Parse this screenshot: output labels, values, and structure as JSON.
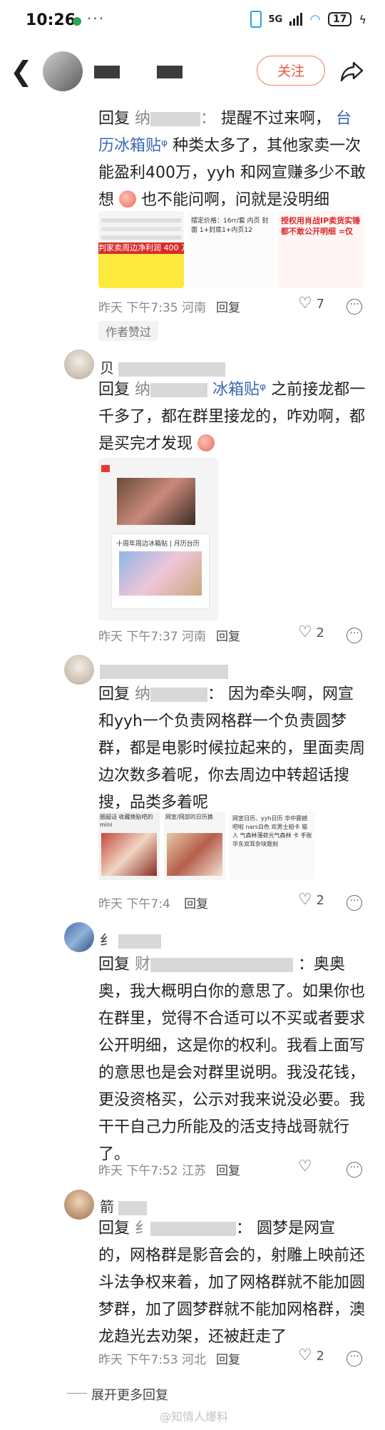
{
  "status_bar": {
    "time": "10:26",
    "network": "5G",
    "battery": "17"
  },
  "header": {
    "follow_label": "关注"
  },
  "comments": [
    {
      "reply_label": "回复",
      "target": "纳",
      "target_suffix": "：",
      "text_before_topic": "提醒不过来啊，",
      "topic": "台历冰箱贴",
      "text_after_topic": "种类太多了，其他家卖一次能盈利400万，yyh 和网宣赚多少不敢想",
      "text_end": "也不能问啊，问就是没明细",
      "thumb_captions": [
        "判家卖周边净利润 400 万",
        "摆定价格：16rr/套 内页 封面 1+封底1+内页12",
        "授权用肖战IP卖货实锤 都不敢公开明细 =仅"
      ],
      "time": "昨天 下午7:35",
      "location": "河南",
      "reply_link": "回复",
      "likes": "7",
      "badge": "作者赞过"
    },
    {
      "name": "贝",
      "reply_label": "回复",
      "target": "纳",
      "topic": "冰箱贴",
      "text": "之前接龙都一千多了，都在群里接龙的，咋劝啊，都是买完才发现",
      "thumb_captions": [
        "十周年周边冰箱贴 | 月历台历"
      ],
      "time": "昨天 下午7:37",
      "location": "河南",
      "reply_link": "回复",
      "likes": "2"
    },
    {
      "reply_label": "回复",
      "target": "纳",
      "text": "因为牵头啊，网宣和yyh一个负责网格群一个负责圆梦群，都是电影时候拉起来的，里面卖周边次数多着呢，你去周边中转超话搜搜，品类多着呢",
      "thumb_captions": [
        "圈超话 收藏挽贴吧的mini",
        "网宣/网部的日历换",
        "网宣日历、yyh日历 华中震撼吧啦 nars白色 欢男士拍卡 猫人 气森林薄荷元气森林 卡 手账 华东双耳杂块题刻"
      ],
      "time": "昨天 下午7:4",
      "location": "",
      "reply_link": "回复",
      "likes": "2"
    },
    {
      "name": "纟",
      "reply_label": "回复",
      "target": "财",
      "text": "：奥奥奥，我大概明白你的意思了。如果你也在群里，觉得不合适可以不买或者要求公开明细，这是你的权利。我看上面写的意思也是会对群里说明。我没花钱，更没资格买，公示对我来说没必要。我干干自己力所能及的活支持战哥就行了。",
      "time": "昨天 下午7:52",
      "location": "江苏",
      "reply_link": "回复",
      "likes": ""
    },
    {
      "name": "箭",
      "reply_label": "回复",
      "target": "纟",
      "text": "圆梦是网宣的，网格群是影音会的，射雕上映前还斗法争权来着，加了网格群就不能加圆梦群，加了圆梦群就不能加网格群，澳龙趋光去劝架，还被赶走了",
      "time": "昨天 下午7:53",
      "location": "河北",
      "reply_link": "回复",
      "likes": "2"
    }
  ],
  "footer": {
    "expand_label": "展开更多回复",
    "watermark": "@知情人爆料"
  },
  "colors": {
    "follow": "#e8523f",
    "topic": "#3a67b0",
    "meta": "#888888"
  },
  "icons": [
    "back-icon",
    "share-icon",
    "heart-icon",
    "more-icon"
  ]
}
